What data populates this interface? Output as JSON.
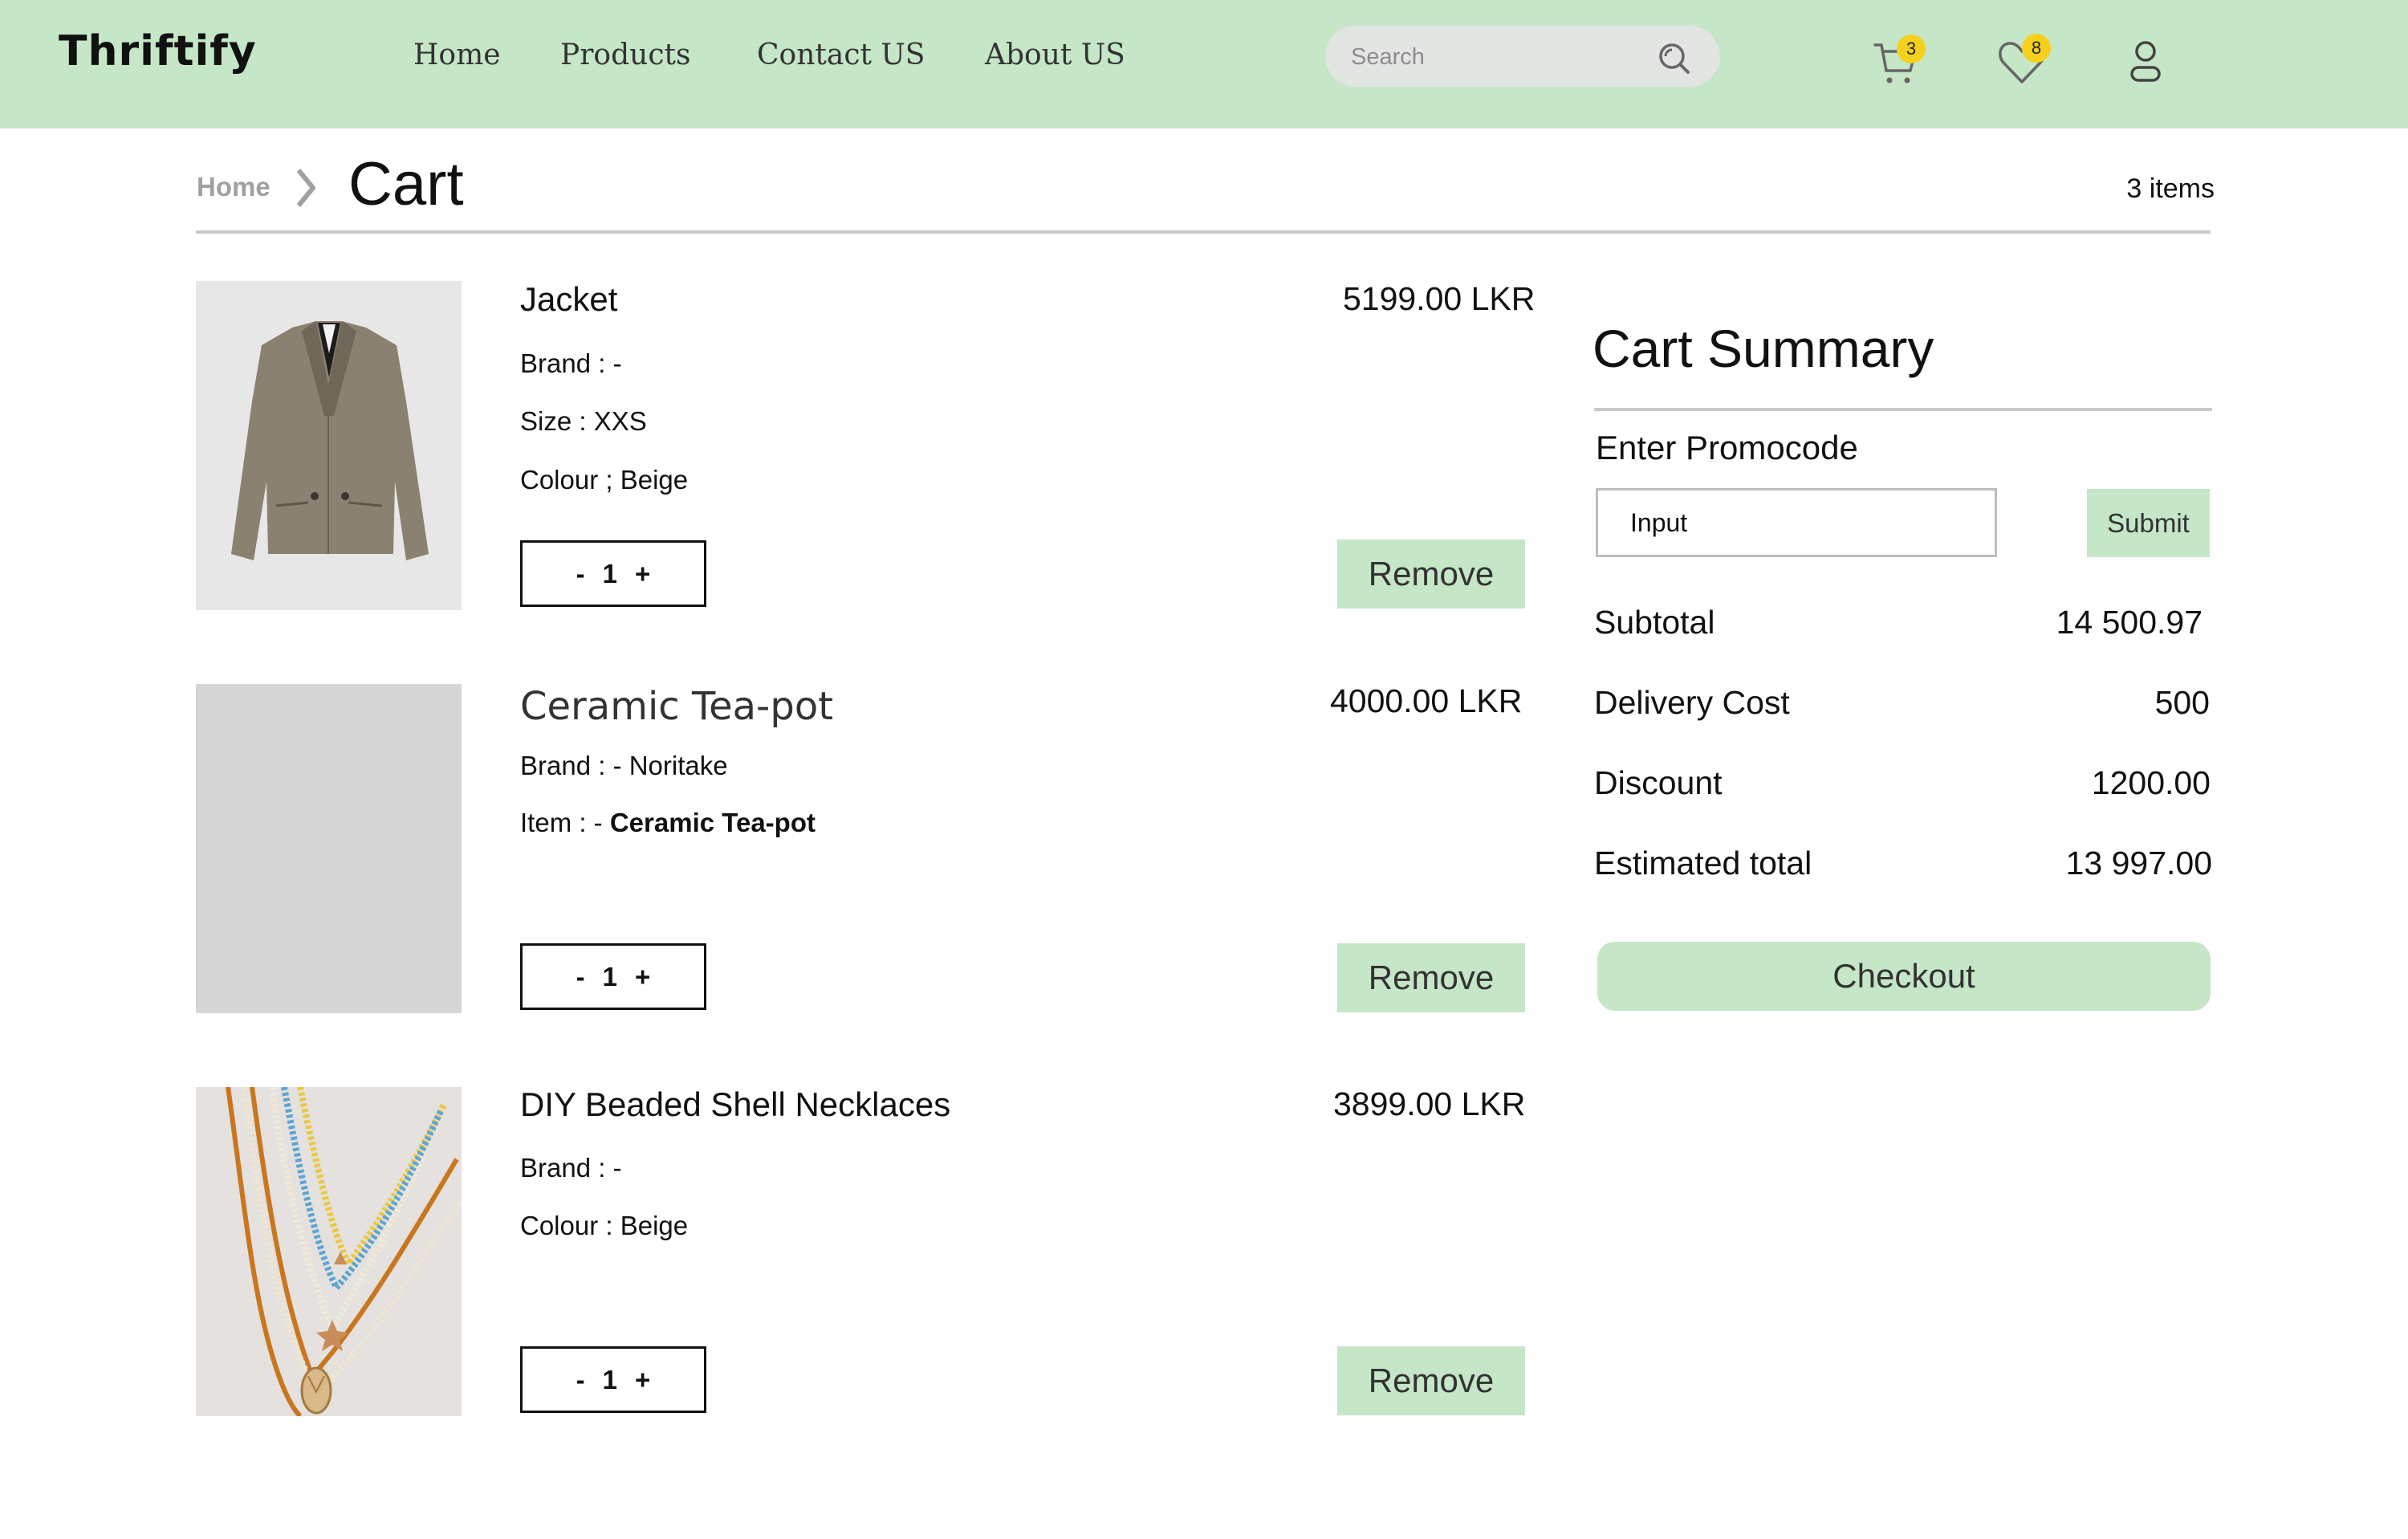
{
  "header": {
    "logo": "Thriftify",
    "nav": [
      "Home",
      "Products",
      "Contact US",
      "About US"
    ],
    "search_placeholder": "Search",
    "cart_badge": "3",
    "wishlist_badge": "8",
    "icons": [
      "search-icon",
      "cart-icon",
      "heart-icon",
      "user-icon"
    ],
    "accent_color": "#c5e6c7",
    "badge_color": "#f5d11d"
  },
  "breadcrumb": {
    "home": "Home",
    "current": "Cart"
  },
  "item_count": "3 items",
  "items": [
    {
      "name": "Jacket",
      "price": "5199.00 LKR",
      "meta": [
        {
          "text": "Brand : -"
        },
        {
          "text": "Size : XXS"
        },
        {
          "text": "Colour ; Beige"
        }
      ],
      "qty": "1",
      "remove_label": "Remove"
    },
    {
      "name": "Ceramic Tea-pot",
      "price": "4000.00 LKR",
      "meta": [
        {
          "text": "Brand : - Noritake"
        },
        {
          "label": "Item : - ",
          "value": "Ceramic Tea-pot"
        }
      ],
      "qty": "1",
      "remove_label": "Remove"
    },
    {
      "name": "DIY Beaded Shell Necklaces",
      "price": "3899.00 LKR",
      "meta": [
        {
          "text": "Brand : -"
        },
        {
          "text": "Colour : Beige"
        }
      ],
      "qty": "1",
      "remove_label": "Remove"
    }
  ],
  "qty_controls": {
    "minus": "-",
    "plus": "+"
  },
  "summary": {
    "title": "Cart Summary",
    "promo_label": "Enter Promocode",
    "promo_value": "Input",
    "submit_label": "Submit",
    "rows": [
      {
        "label": "Subtotal",
        "value": "14 500.97"
      },
      {
        "label": "Delivery Cost",
        "value": "500"
      },
      {
        "label": "Discount",
        "value": "1200.00"
      },
      {
        "label": "Estimated total",
        "value": "13 997.00"
      }
    ],
    "checkout_label": "Checkout"
  }
}
